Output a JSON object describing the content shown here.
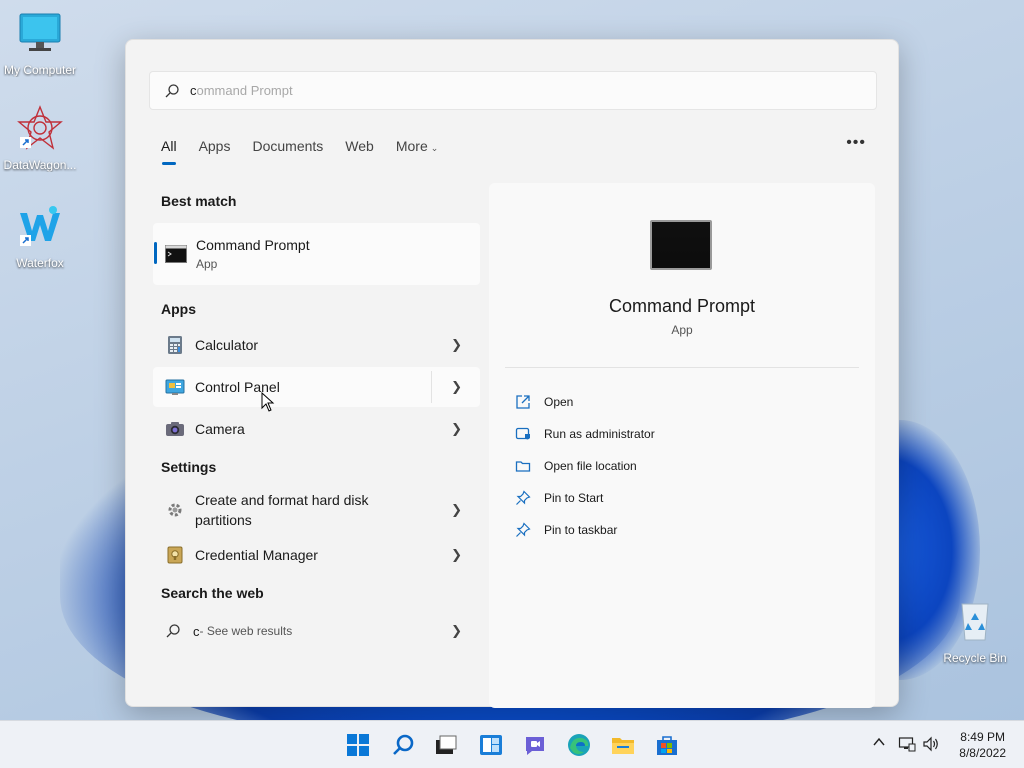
{
  "desktop": {
    "icons": [
      {
        "label": "My Computer",
        "icon": "monitor-icon"
      },
      {
        "label": "DataWagon...",
        "icon": "datawagon-icon"
      },
      {
        "label": "Waterfox",
        "icon": "waterfox-icon"
      },
      {
        "label": "Recycle Bin",
        "icon": "recycle-bin-icon"
      }
    ]
  },
  "search": {
    "typed": "c",
    "placeholder_rest": "ommand Prompt"
  },
  "tabs": [
    {
      "label": "All",
      "active": true
    },
    {
      "label": "Apps"
    },
    {
      "label": "Documents"
    },
    {
      "label": "Web"
    },
    {
      "label": "More"
    }
  ],
  "best_match": {
    "heading": "Best match",
    "name": "Command Prompt",
    "type": "App"
  },
  "apps": {
    "heading": "Apps",
    "items": [
      {
        "name": "Calculator",
        "icon": "calculator-icon"
      },
      {
        "name": "Control Panel",
        "icon": "control-panel-icon"
      },
      {
        "name": "Camera",
        "icon": "camera-icon"
      }
    ]
  },
  "settings": {
    "heading": "Settings",
    "items": [
      {
        "name_line1": "Create and format hard disk",
        "name_line2": "partitions",
        "icon": "disk-settings-icon"
      },
      {
        "name": "Credential Manager",
        "icon": "credential-manager-icon"
      }
    ]
  },
  "web": {
    "heading": "Search the web",
    "query": "c",
    "suffix": " - See web results"
  },
  "preview": {
    "title": "Command Prompt",
    "type": "App",
    "actions": [
      {
        "label": "Open",
        "icon": "open-external-icon"
      },
      {
        "label": "Run as administrator",
        "icon": "shield-admin-icon"
      },
      {
        "label": "Open file location",
        "icon": "folder-icon"
      },
      {
        "label": "Pin to Start",
        "icon": "pin-icon"
      },
      {
        "label": "Pin to taskbar",
        "icon": "pin-icon"
      }
    ]
  },
  "taskbar": {
    "time": "8:49 PM",
    "date": "8/8/2022"
  },
  "colors": {
    "accent": "#0067c0"
  }
}
